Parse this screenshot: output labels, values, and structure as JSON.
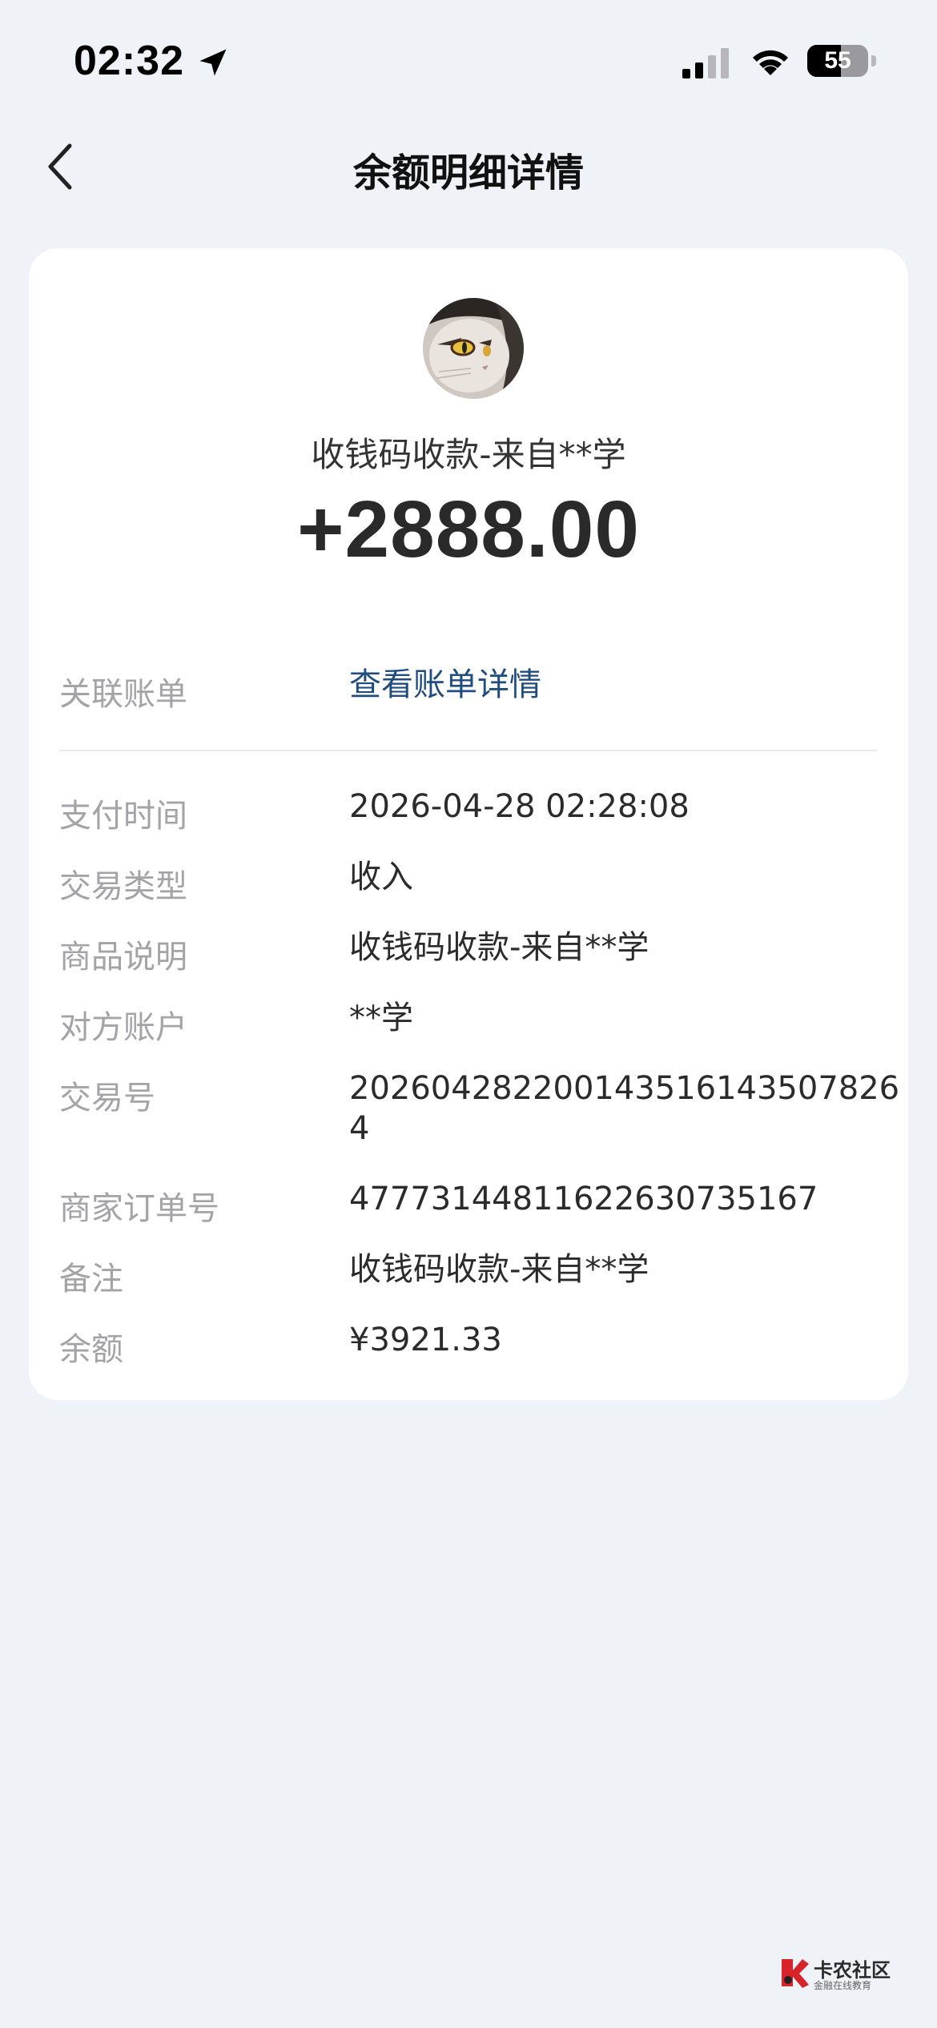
{
  "status_bar": {
    "time": "02:32",
    "battery_level": "55",
    "icons": [
      "location-arrow-icon",
      "signal-icon",
      "wifi-icon",
      "battery-icon"
    ]
  },
  "nav": {
    "back_icon": "chevron-left-icon",
    "title": "余额明细详情"
  },
  "transaction": {
    "title": "收钱码收款-来自**学",
    "amount": "+2888.00"
  },
  "linked_bill": {
    "label": "关联账单",
    "value": "查看账单详情"
  },
  "details": [
    {
      "label": "支付时间",
      "value": "2026-04-28 02:28:08"
    },
    {
      "label": "交易类型",
      "value": "收入"
    },
    {
      "label": "商品说明",
      "value": "收钱码收款-来自**学"
    },
    {
      "label": "对方账户",
      "value": "**学"
    },
    {
      "label": "交易号",
      "value": "2026042822001435161435078264"
    },
    {
      "label": "商家订单号",
      "value": "47773144811622630735167"
    },
    {
      "label": "备注",
      "value": "收钱码收款-来自**学"
    },
    {
      "label": "余额",
      "value": "¥3921.33"
    }
  ],
  "watermark": {
    "title": "卡农社区",
    "subtitle": "金融在线教育"
  },
  "colors": {
    "background": "#eff2f7",
    "card": "#ffffff",
    "link": "#1f4d80",
    "label": "#a3a3a8"
  }
}
